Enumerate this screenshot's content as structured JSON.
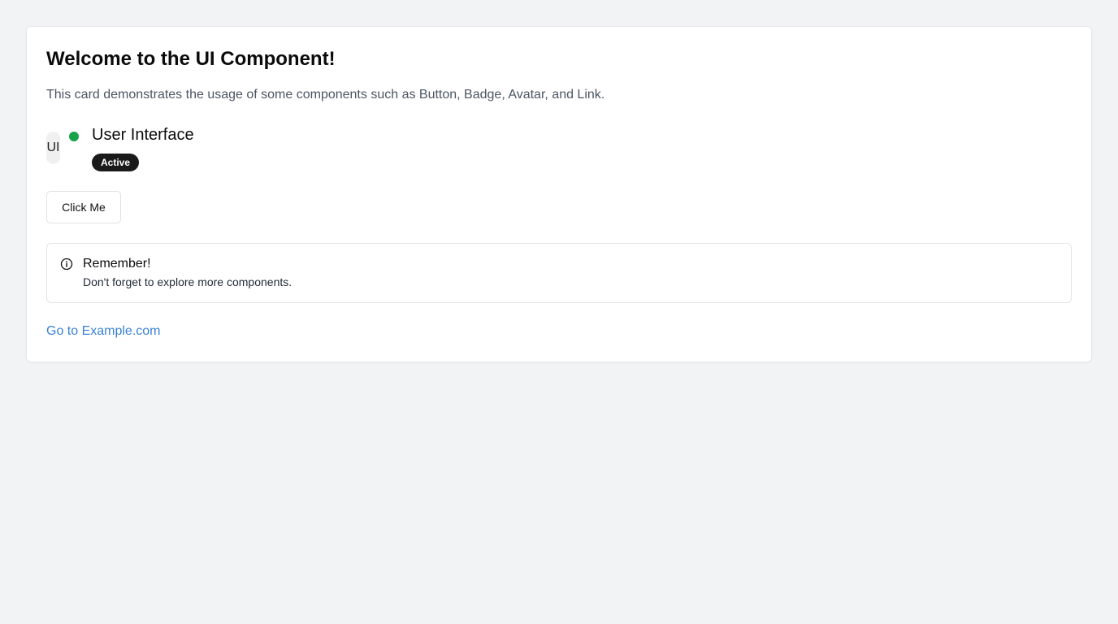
{
  "card": {
    "title": "Welcome to the UI Component!",
    "description": "This card demonstrates the usage of some components such as Button, Badge, Avatar, and Link."
  },
  "user": {
    "avatar_initials": "UI",
    "name": "User Interface",
    "status_color": "#16a34a",
    "badge_label": "Active"
  },
  "button": {
    "label": "Click Me"
  },
  "alert": {
    "icon": "info-icon",
    "title": "Remember!",
    "description": "Don't forget to explore more components."
  },
  "link": {
    "label": "Go to Example.com",
    "color": "#3b82d6"
  }
}
